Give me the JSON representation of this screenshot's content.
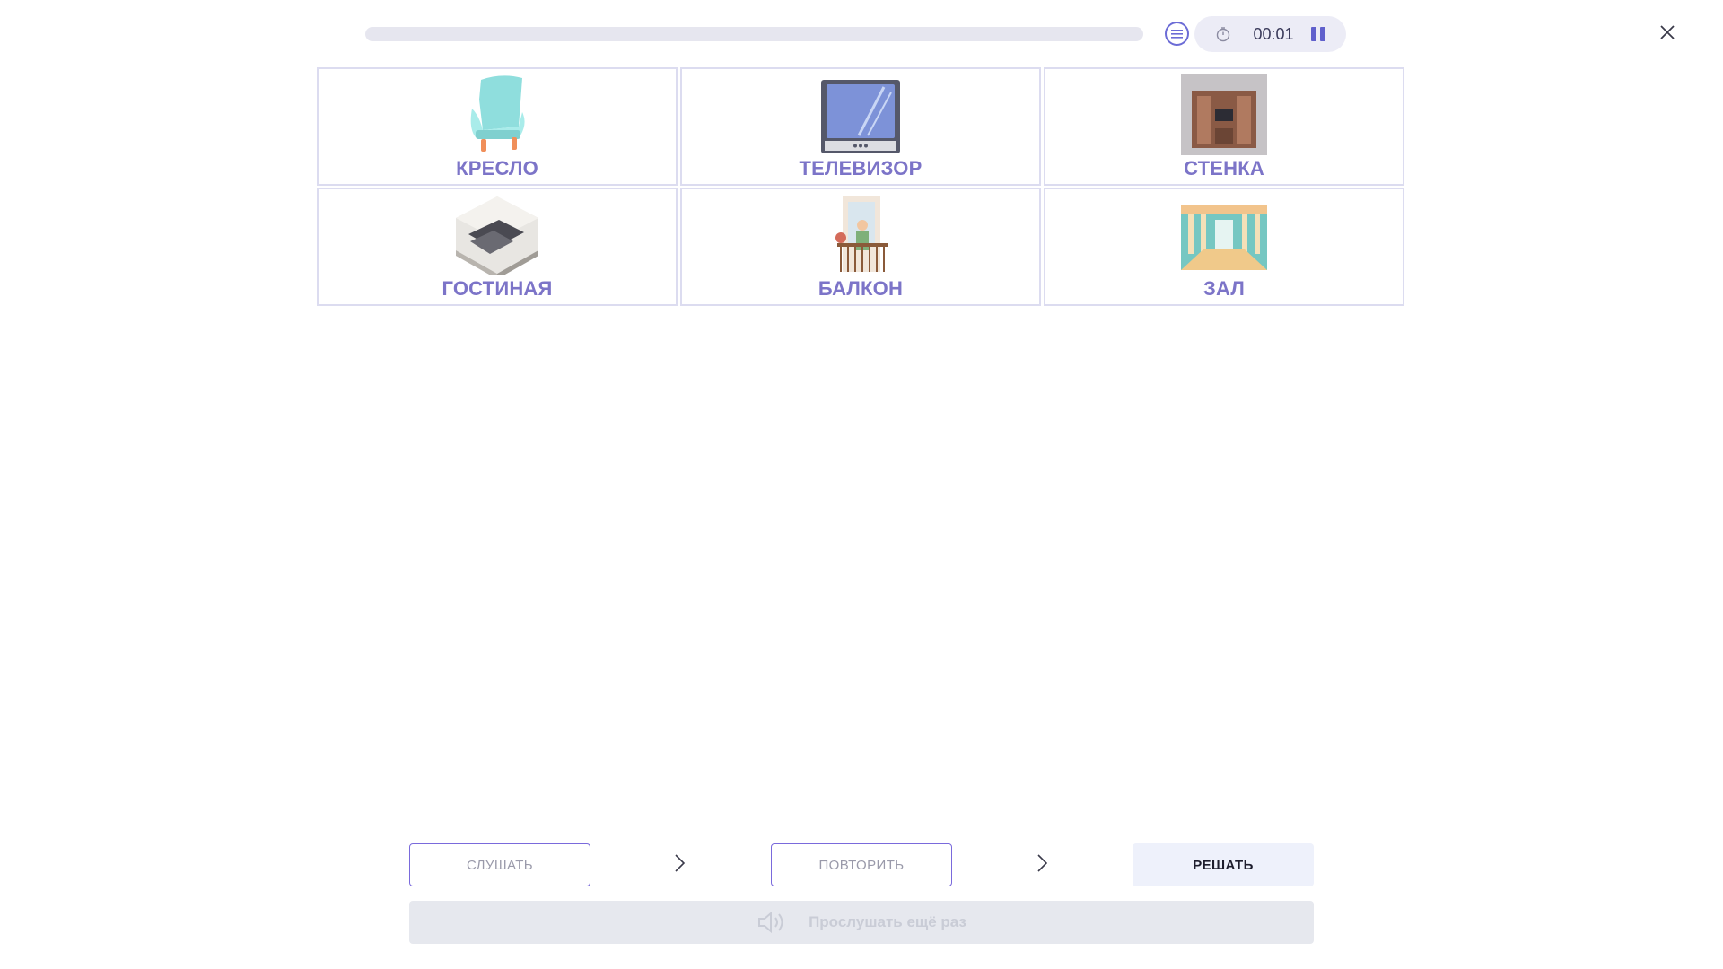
{
  "header": {
    "progress": 0,
    "timer": "00:01"
  },
  "cards": [
    {
      "label": "КРЕСЛО",
      "icon": "armchair-icon"
    },
    {
      "label": "ТЕЛЕВИЗОР",
      "icon": "tv-icon"
    },
    {
      "label": "СТЕНКА",
      "icon": "wall-unit-icon"
    },
    {
      "label": "ГОСТИНАЯ",
      "icon": "living-room-icon"
    },
    {
      "label": "БАЛКОН",
      "icon": "balcony-icon"
    },
    {
      "label": "ЗАЛ",
      "icon": "hall-icon"
    }
  ],
  "steps": [
    {
      "label": "СЛУШАТЬ",
      "active": false
    },
    {
      "label": "ПОВТОРИТЬ",
      "active": false
    },
    {
      "label": "РЕШАТЬ",
      "active": true
    }
  ],
  "listen_again": "Прослушать ещё раз",
  "colors": {
    "accent": "#6c6cd6",
    "label": "#7c74c8",
    "card_border": "#dcdcf0"
  }
}
